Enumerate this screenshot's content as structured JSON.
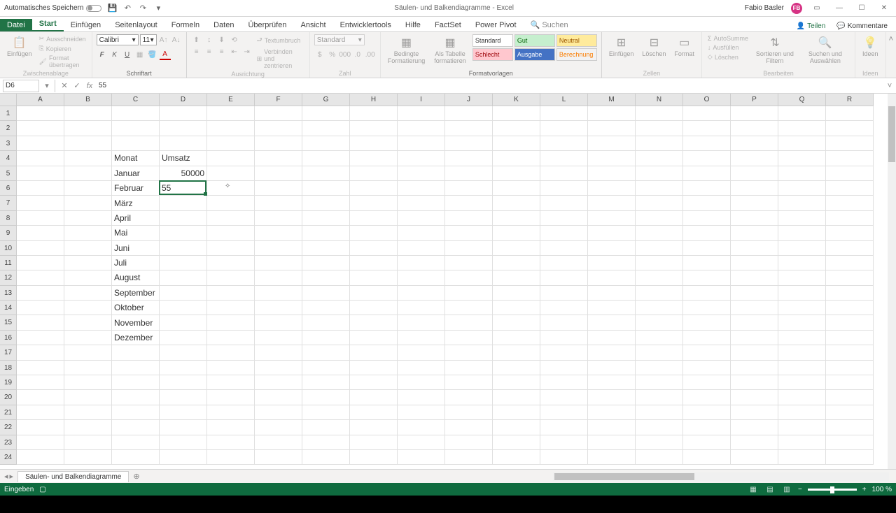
{
  "titlebar": {
    "autosave": "Automatisches Speichern",
    "title": "Säulen- und Balkendiagramme - Excel",
    "user": "Fabio Basler",
    "avatar": "FB"
  },
  "tabs": {
    "file": "Datei",
    "items": [
      "Start",
      "Einfügen",
      "Seitenlayout",
      "Formeln",
      "Daten",
      "Überprüfen",
      "Ansicht",
      "Entwicklertools",
      "Hilfe",
      "FactSet",
      "Power Pivot"
    ],
    "search_placeholder": "Suchen",
    "share": "Teilen",
    "comments": "Kommentare"
  },
  "ribbon": {
    "clipboard": {
      "paste": "Einfügen",
      "cut": "Ausschneiden",
      "copy": "Kopieren",
      "format": "Format übertragen",
      "label": "Zwischenablage"
    },
    "font": {
      "name": "Calibri",
      "size": "11",
      "label": "Schriftart"
    },
    "align": {
      "wrap": "Textumbruch",
      "merge": "Verbinden und zentrieren",
      "label": "Ausrichtung"
    },
    "number": {
      "format": "Standard",
      "label": "Zahl"
    },
    "styles": {
      "cond": "Bedingte\nFormatierung",
      "table": "Als Tabelle\nformatieren",
      "std": "Standard",
      "bad": "Schlecht",
      "good": "Gut",
      "neutral": "Neutral",
      "output": "Ausgabe",
      "calc": "Berechnung",
      "label": "Formatvorlagen"
    },
    "cells": {
      "insert": "Einfügen",
      "delete": "Löschen",
      "format": "Format",
      "label": "Zellen"
    },
    "editing": {
      "sum": "AutoSumme",
      "fill": "Ausfüllen",
      "clear": "Löschen",
      "sort": "Sortieren und\nFiltern",
      "find": "Suchen und\nAuswählen",
      "label": "Bearbeiten"
    },
    "ideas": {
      "label": "Ideen",
      "btn": "Ideen"
    }
  },
  "fbar": {
    "namebox": "D6",
    "formula": "55"
  },
  "grid": {
    "cols": [
      "A",
      "B",
      "C",
      "D",
      "E",
      "F",
      "G",
      "H",
      "I",
      "J",
      "K",
      "L",
      "M",
      "N",
      "O",
      "P",
      "Q",
      "R"
    ],
    "rows": 24,
    "data": {
      "C4": "Monat",
      "D4": "Umsatz",
      "C5": "Januar",
      "D5": "50000",
      "C6": "Februar",
      "D6": "55",
      "C7": "März",
      "C8": "April",
      "C9": "Mai",
      "C10": "Juni",
      "C11": "Juli",
      "C12": "August",
      "C13": "September",
      "C14": "Oktober",
      "C15": "November",
      "C16": "Dezember"
    },
    "active": "D6"
  },
  "sheets": {
    "tab1": "Säulen- und Balkendiagramme"
  },
  "statusbar": {
    "mode": "Eingeben",
    "zoom": "100 %"
  }
}
